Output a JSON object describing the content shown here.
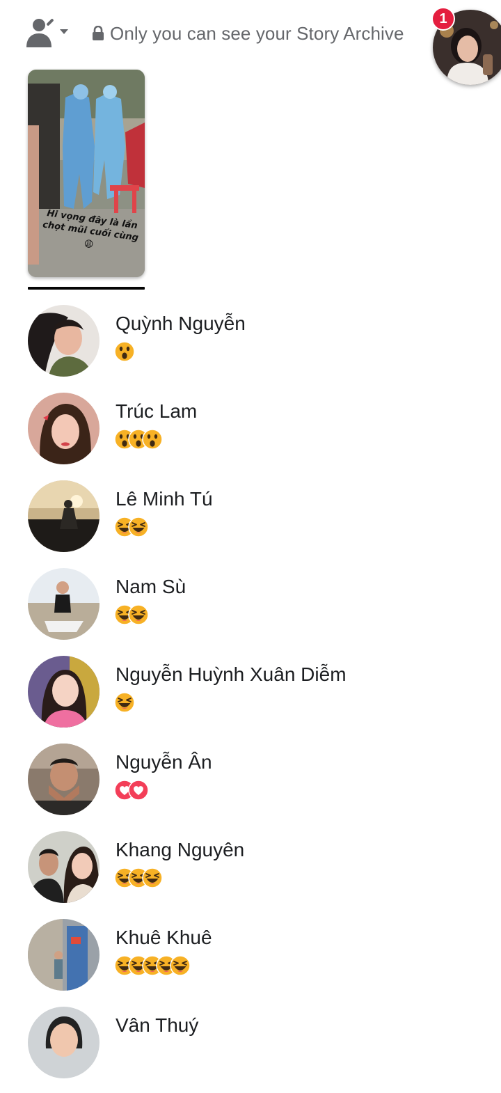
{
  "header": {
    "audience_icon": "people-settings-icon",
    "lock_icon": "lock-icon",
    "privacy_notice": "Only you can see your Story Archive",
    "notification_count": "1"
  },
  "story": {
    "caption_line1": "Hi vọng đây là lần",
    "caption_line2": "chọt mũi cuối cùng",
    "caption_emoji": "😩"
  },
  "viewers": [
    {
      "name": "Quỳnh Nguyễn",
      "reactions": [
        "wow"
      ]
    },
    {
      "name": "Trúc Lam",
      "reactions": [
        "wow",
        "wow",
        "wow"
      ]
    },
    {
      "name": "Lê Minh Tú",
      "reactions": [
        "haha",
        "haha"
      ]
    },
    {
      "name": "Nam Sù",
      "reactions": [
        "haha",
        "haha"
      ]
    },
    {
      "name": "Nguyễn Huỳnh Xuân Diễm",
      "reactions": [
        "haha"
      ]
    },
    {
      "name": "Nguyễn Ân",
      "reactions": [
        "love",
        "love"
      ]
    },
    {
      "name": "Khang Nguyên",
      "reactions": [
        "haha",
        "haha",
        "haha"
      ]
    },
    {
      "name": "Khuê Khuê",
      "reactions": [
        "haha",
        "haha",
        "haha",
        "haha",
        "haha"
      ]
    },
    {
      "name": "Vân Thuý",
      "reactions": []
    }
  ],
  "colors": {
    "badge": "#e41e3f",
    "secondary_text": "#65676b",
    "reaction_yellow": "#f7b125",
    "love_red": "#f33e58"
  }
}
